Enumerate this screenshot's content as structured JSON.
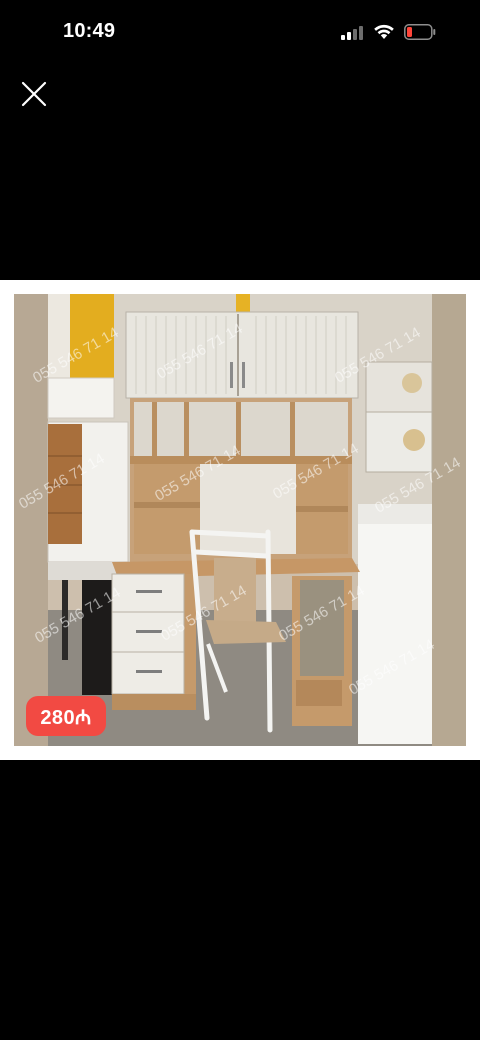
{
  "status_bar": {
    "time": "10:49",
    "icons": [
      "cellular-signal-icon",
      "wifi-icon",
      "battery-low-icon"
    ],
    "battery_color": "#ff453a"
  },
  "viewer": {
    "close_icon": "close-icon"
  },
  "photo": {
    "subject": "study desk with hutch, drawers and chair",
    "watermark_text": "055 546 71 14",
    "price": "280₼",
    "price_badge_color": "#f24a43"
  }
}
